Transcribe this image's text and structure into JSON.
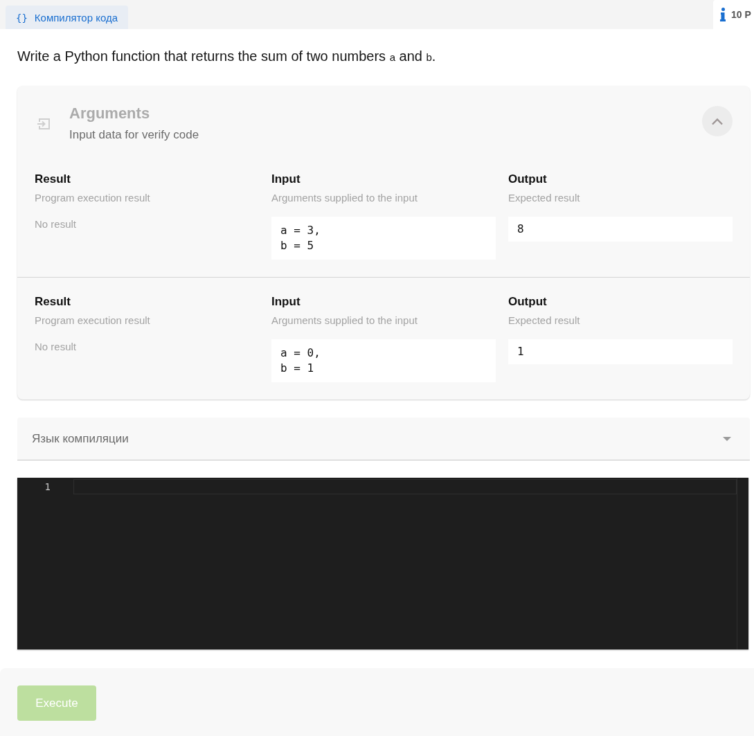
{
  "top_bar": {
    "tab": {
      "icon": "{}",
      "label": "Компилятор кода",
      "selected": true
    },
    "info_tab": {
      "label": "10 P"
    }
  },
  "prompt": [
    {
      "kind": "text",
      "text": "Write a Python function that returns the sum of two numbers "
    },
    {
      "kind": "code",
      "text": "a"
    },
    {
      "kind": "text",
      "text": " and "
    },
    {
      "kind": "code",
      "text": "b"
    },
    {
      "kind": "text",
      "text": "."
    }
  ],
  "arguments": {
    "title": "Arguments",
    "subtitle": "Input data for verify code",
    "expanded": true,
    "tests": [
      {
        "result": {
          "title": "Result",
          "hint": "Program execution result",
          "value": "No result"
        },
        "input": {
          "title": "Input",
          "hint": "Arguments supplied to the input",
          "value": "a = 3,\nb = 5"
        },
        "output": {
          "title": "Output",
          "hint": "Expected result",
          "value": "8"
        }
      },
      {
        "result": {
          "title": "Result",
          "hint": "Program execution result",
          "value": "No result"
        },
        "input": {
          "title": "Input",
          "hint": "Arguments supplied to the input",
          "value": "a = 0,\nb = 1"
        },
        "output": {
          "title": "Output",
          "hint": "Expected result",
          "value": "1"
        }
      }
    ]
  },
  "language_select": {
    "placeholder": "Язык компиляции"
  },
  "editor": {
    "line_numbers": [
      "1"
    ]
  },
  "execute_button": {
    "label": "Execute",
    "disabled": true
  }
}
